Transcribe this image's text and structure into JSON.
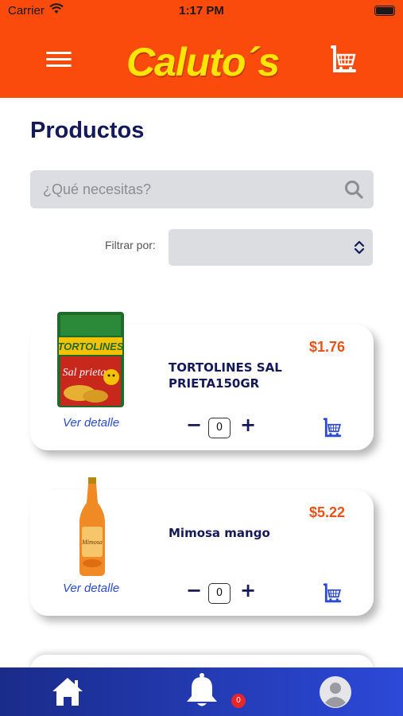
{
  "status_bar": {
    "carrier": "Carrier",
    "time": "1:17 PM"
  },
  "header": {
    "logo_text": "Caluto´s",
    "menu_icon": "hamburger-icon",
    "cart_icon": "cart-icon"
  },
  "page": {
    "title": "Productos"
  },
  "search": {
    "placeholder": "¿Qué necesitas?",
    "value": ""
  },
  "filter": {
    "label": "Filtrar por:",
    "selected": ""
  },
  "products": [
    {
      "name": "TORTOLINES SAL PRIETA150GR",
      "price": "$1.76",
      "detail_label": "Ver detalle",
      "quantity": "0",
      "minus": "−",
      "plus": "+"
    },
    {
      "name": "Mimosa mango",
      "price": "$5.22",
      "detail_label": "Ver detalle",
      "quantity": "0",
      "minus": "−",
      "plus": "+"
    }
  ],
  "bottom_nav": {
    "notification_count": "0"
  },
  "colors": {
    "brand": "#fa4a0c",
    "logo": "#ffe600",
    "navy": "#14195a",
    "price": "#e8531a",
    "link": "#2c4bd4",
    "nav_start": "#1a2b8a",
    "nav_end": "#2c49d8"
  }
}
